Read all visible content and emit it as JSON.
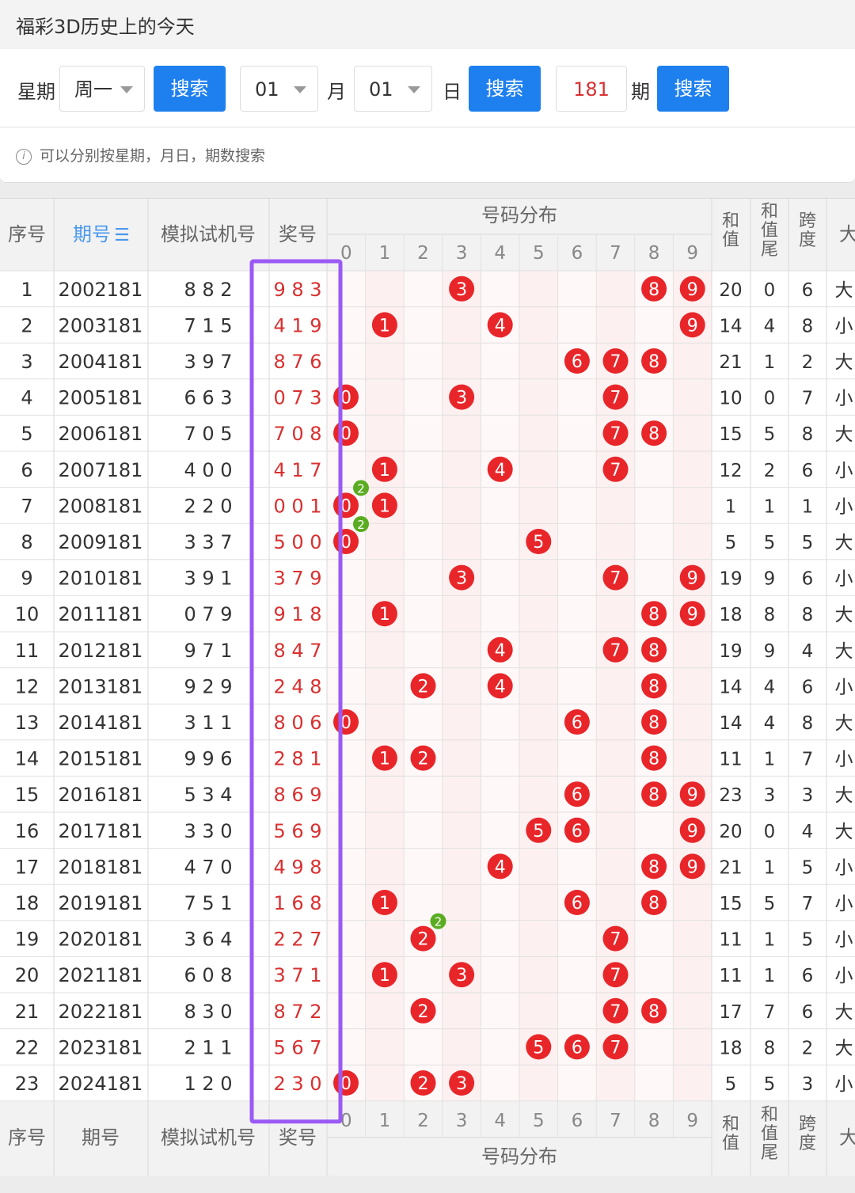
{
  "title": "福彩3D历史上的今天",
  "search": {
    "weekday_label": "星期",
    "weekday_value": "周一",
    "search_btn": "搜索",
    "month_value": "01",
    "month_label": "月",
    "day_value": "01",
    "day_label": "日",
    "period_value": "181",
    "period_label": "期",
    "hint_icon": "i",
    "hint": "可以分别按星期，月日，期数搜索"
  },
  "table": {
    "headers": {
      "seq": "序号",
      "period": "期号",
      "sort_icon": "sort-icon",
      "trial": "模拟试机号",
      "prize": "奖号",
      "dist": "号码分布",
      "sum": "和值",
      "sum_tail": "和值尾",
      "span": "跨度",
      "size": "大"
    },
    "digits": [
      "0",
      "1",
      "2",
      "3",
      "4",
      "5",
      "6",
      "7",
      "8",
      "9"
    ],
    "rows": [
      {
        "seq": "1",
        "period": "2002181",
        "trial": "8 8 2",
        "prize": "9 8 3",
        "sum": "20",
        "tail": "0",
        "span": "6",
        "size": "大"
      },
      {
        "seq": "2",
        "period": "2003181",
        "trial": "7 1 5",
        "prize": "4 1 9",
        "sum": "14",
        "tail": "4",
        "span": "8",
        "size": "小"
      },
      {
        "seq": "3",
        "period": "2004181",
        "trial": "3 9 7",
        "prize": "8 7 6",
        "sum": "21",
        "tail": "1",
        "span": "2",
        "size": "大"
      },
      {
        "seq": "4",
        "period": "2005181",
        "trial": "6 6 3",
        "prize": "0 7 3",
        "sum": "10",
        "tail": "0",
        "span": "7",
        "size": "小"
      },
      {
        "seq": "5",
        "period": "2006181",
        "trial": "7 0 5",
        "prize": "7 0 8",
        "sum": "15",
        "tail": "5",
        "span": "8",
        "size": "大"
      },
      {
        "seq": "6",
        "period": "2007181",
        "trial": "4 0 0",
        "prize": "4 1 7",
        "sum": "12",
        "tail": "2",
        "span": "6",
        "size": "小"
      },
      {
        "seq": "7",
        "period": "2008181",
        "trial": "2 2 0",
        "prize": "0 0 1",
        "sum": "1",
        "tail": "1",
        "span": "1",
        "size": "小"
      },
      {
        "seq": "8",
        "period": "2009181",
        "trial": "3 3 7",
        "prize": "5 0 0",
        "sum": "5",
        "tail": "5",
        "span": "5",
        "size": "大"
      },
      {
        "seq": "9",
        "period": "2010181",
        "trial": "3 9 1",
        "prize": "3 7 9",
        "sum": "19",
        "tail": "9",
        "span": "6",
        "size": "小"
      },
      {
        "seq": "10",
        "period": "2011181",
        "trial": "0 7 9",
        "prize": "9 1 8",
        "sum": "18",
        "tail": "8",
        "span": "8",
        "size": "大"
      },
      {
        "seq": "11",
        "period": "2012181",
        "trial": "9 7 1",
        "prize": "8 4 7",
        "sum": "19",
        "tail": "9",
        "span": "4",
        "size": "大"
      },
      {
        "seq": "12",
        "period": "2013181",
        "trial": "9 2 9",
        "prize": "2 4 8",
        "sum": "14",
        "tail": "4",
        "span": "6",
        "size": "小"
      },
      {
        "seq": "13",
        "period": "2014181",
        "trial": "3 1 1",
        "prize": "8 0 6",
        "sum": "14",
        "tail": "4",
        "span": "8",
        "size": "大"
      },
      {
        "seq": "14",
        "period": "2015181",
        "trial": "9 9 6",
        "prize": "2 8 1",
        "sum": "11",
        "tail": "1",
        "span": "7",
        "size": "小"
      },
      {
        "seq": "15",
        "period": "2016181",
        "trial": "5 3 4",
        "prize": "8 6 9",
        "sum": "23",
        "tail": "3",
        "span": "3",
        "size": "大"
      },
      {
        "seq": "16",
        "period": "2017181",
        "trial": "3 3 0",
        "prize": "5 6 9",
        "sum": "20",
        "tail": "0",
        "span": "4",
        "size": "大"
      },
      {
        "seq": "17",
        "period": "2018181",
        "trial": "4 7 0",
        "prize": "4 9 8",
        "sum": "21",
        "tail": "1",
        "span": "5",
        "size": "小"
      },
      {
        "seq": "18",
        "period": "2019181",
        "trial": "7 5 1",
        "prize": "1 6 8",
        "sum": "15",
        "tail": "5",
        "span": "7",
        "size": "小"
      },
      {
        "seq": "19",
        "period": "2020181",
        "trial": "3 6 4",
        "prize": "2 2 7",
        "sum": "11",
        "tail": "1",
        "span": "5",
        "size": "小"
      },
      {
        "seq": "20",
        "period": "2021181",
        "trial": "6 0 8",
        "prize": "3 7 1",
        "sum": "11",
        "tail": "1",
        "span": "6",
        "size": "小"
      },
      {
        "seq": "21",
        "period": "2022181",
        "trial": "8 3 0",
        "prize": "8 7 2",
        "sum": "17",
        "tail": "7",
        "span": "6",
        "size": "大"
      },
      {
        "seq": "22",
        "period": "2023181",
        "trial": "2 1 1",
        "prize": "5 6 7",
        "sum": "18",
        "tail": "8",
        "span": "2",
        "size": "大"
      },
      {
        "seq": "23",
        "period": "2024181",
        "trial": "1 2 0",
        "prize": "2 3 0",
        "sum": "5",
        "tail": "5",
        "span": "3",
        "size": "小"
      }
    ]
  },
  "colors": {
    "accent": "#1e80ef",
    "ball_red": "#e8262a",
    "ball_green": "#5aac21",
    "prize_text": "#d93030",
    "highlight_box": "#9b59f5",
    "pink_stripe": "#fdeeee"
  }
}
